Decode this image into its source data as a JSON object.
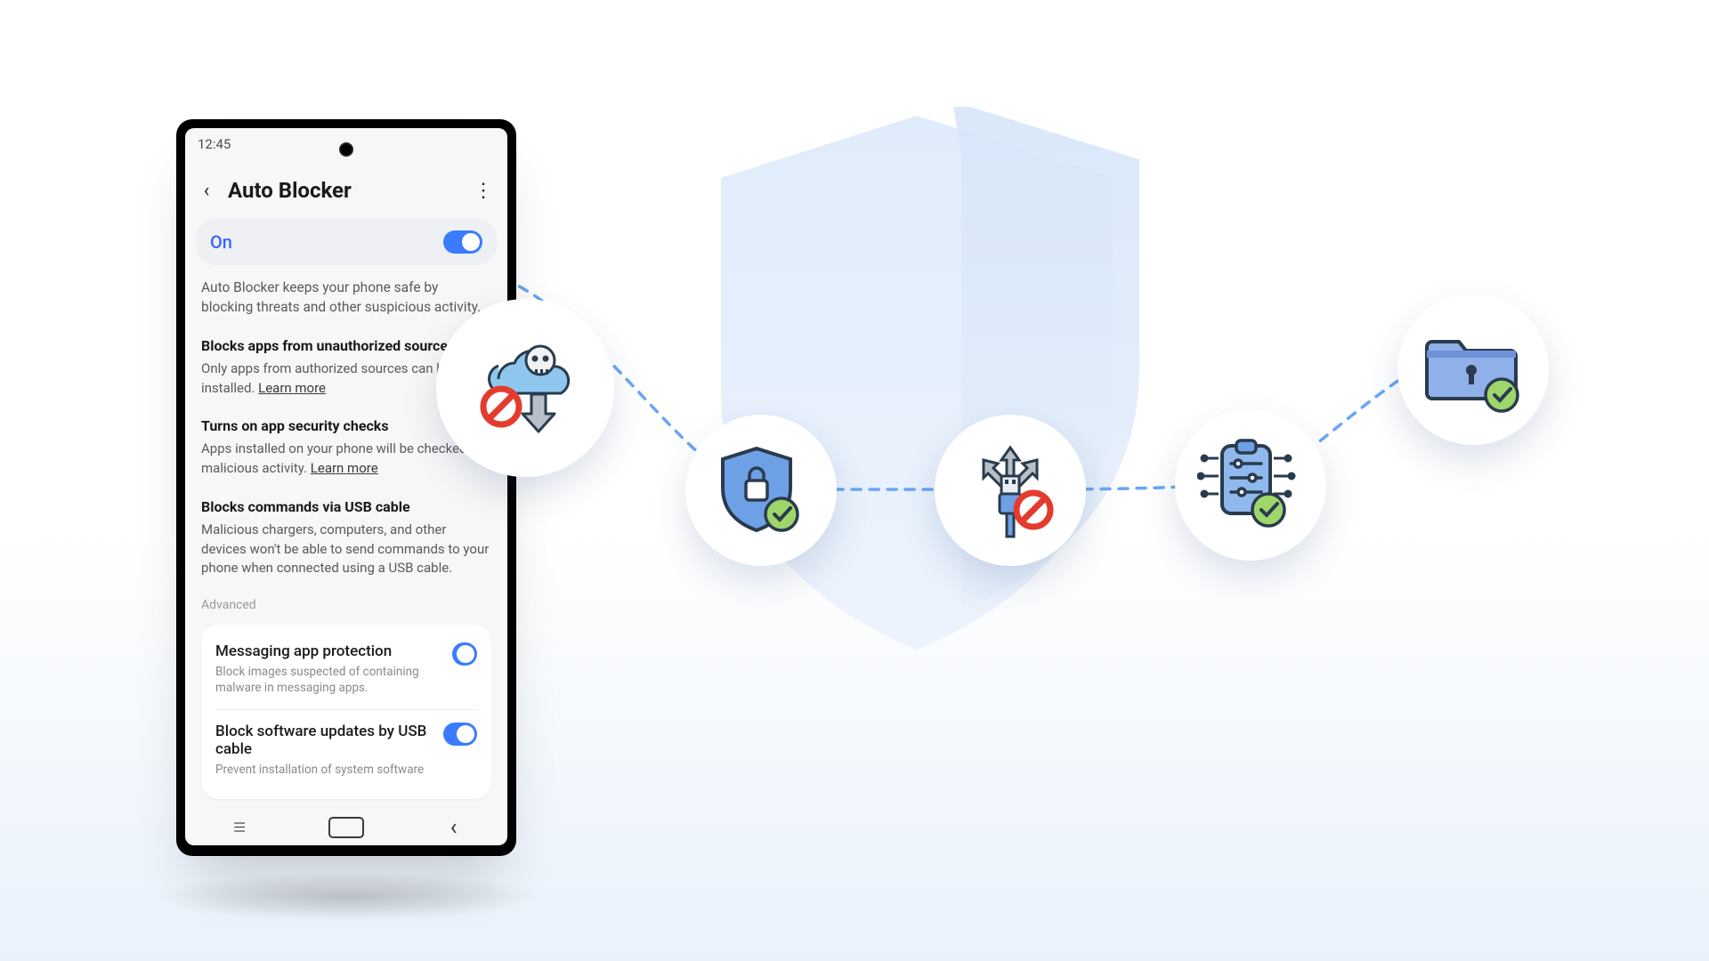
{
  "statusbar": {
    "time": "12:45"
  },
  "appbar": {
    "title": "Auto Blocker"
  },
  "main_toggle": {
    "label": "On",
    "value": true
  },
  "description": "Auto Blocker keeps your phone safe by blocking threats and other suspicious activity.",
  "sections": [
    {
      "title": "Blocks apps from unauthorized sources",
      "body_prefix": "Only apps from authorized sources can be installed. ",
      "learn_more": "Learn more"
    },
    {
      "title": "Turns on app security checks",
      "body_prefix": "Apps installed on your phone will be checked for malicious activity. ",
      "learn_more": "Learn more"
    },
    {
      "title": "Blocks commands via USB cable",
      "body_prefix": "Malicious chargers, computers, and other devices won't be able to send commands to your phone when connected using a USB cable.",
      "learn_more": ""
    }
  ],
  "advanced_label": "Advanced",
  "advanced": [
    {
      "title": "Messaging app protection",
      "subtitle": "Block images suspected of containing malware in messaging apps.",
      "value": true
    },
    {
      "title": "Block software updates by USB cable",
      "subtitle": "Prevent installation of system software",
      "value": true
    }
  ],
  "bubbles": [
    {
      "name": "malware-cloud-block-icon"
    },
    {
      "name": "shield-lock-check-icon"
    },
    {
      "name": "usb-block-icon"
    },
    {
      "name": "clipboard-check-icon"
    },
    {
      "name": "folder-lock-check-icon"
    }
  ]
}
